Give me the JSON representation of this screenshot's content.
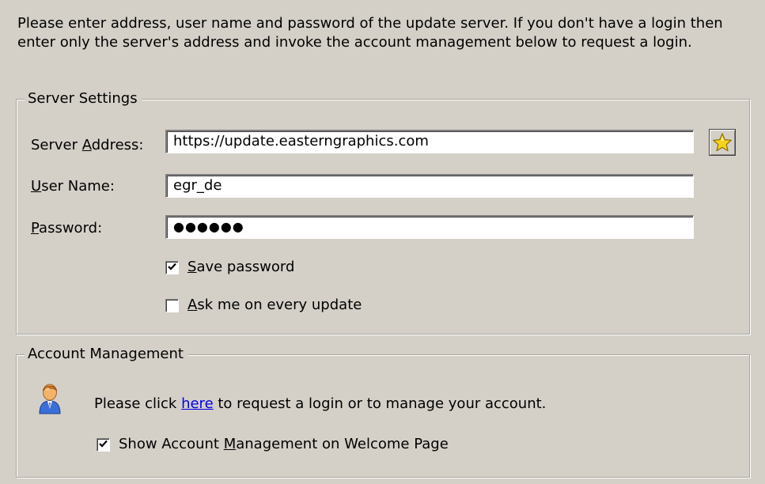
{
  "intro_text": "Please enter address, user name and password of the update server. If you don't have a login then enter only the server's address and invoke the account management below to request a login.",
  "server_settings": {
    "title": "Server Settings",
    "address": {
      "label_pre": "Server ",
      "label_key": "A",
      "label_post": "ddress:",
      "value": "https://update.easterngraphics.com"
    },
    "username": {
      "label_key": "U",
      "label_post": "ser Name:",
      "value": "egr_de"
    },
    "password": {
      "label_key": "P",
      "label_post": "assword:",
      "masked_value": "●●●●●●"
    },
    "save_password": {
      "label_key": "S",
      "label_post": "ave password",
      "checked": true
    },
    "ask_every_update": {
      "label_key": "A",
      "label_post": "sk me on every update",
      "checked": false
    },
    "favorite_button_icon": "star-icon"
  },
  "account_management": {
    "title": "Account Management",
    "text_pre": "Please click ",
    "link_text": "here",
    "text_post": " to request a login or to manage your account.",
    "show_on_welcome": {
      "label_pre": "Show Account ",
      "label_key": "M",
      "label_post": "anagement on Welcome Page",
      "checked": true
    },
    "avatar_icon": "user-icon"
  },
  "colors": {
    "window_bg": "#d4d0c8",
    "link": "#0000ee",
    "star": "#f7d21c"
  }
}
